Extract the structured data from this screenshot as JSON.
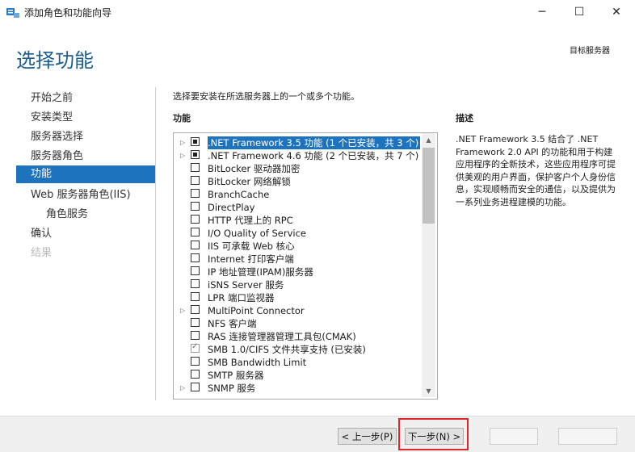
{
  "window": {
    "title": "添加角色和功能向导",
    "minimize": "─",
    "maximize": "☐",
    "close": "✕"
  },
  "header": {
    "page_title": "选择功能",
    "target_server_label": "目标服务器"
  },
  "nav": {
    "items": [
      {
        "label": "开始之前"
      },
      {
        "label": "安装类型"
      },
      {
        "label": "服务器选择"
      },
      {
        "label": "服务器角色"
      },
      {
        "label": "功能"
      },
      {
        "label": "Web 服务器角色(IIS)"
      },
      {
        "label": "角色服务"
      },
      {
        "label": "确认"
      },
      {
        "label": "结果"
      }
    ]
  },
  "content": {
    "instruction": "选择要安装在所选服务器上的一个或多个功能。",
    "features_label": "功能",
    "description_label": "描述",
    "description_text": ".NET Framework 3.5 结合了 .NET Framework 2.0 API 的功能和用于构建应用程序的全新技术，这些应用程序可提供美观的用户界面，保护客户个人身份信息，实现顺畅而安全的通信，以及提供为一系列业务进程建模的功能。",
    "features": [
      {
        "label": ".NET Framework 3.5 功能 (1 个已安装，共 3 个)",
        "expandable": true,
        "state": "partial",
        "selected": true
      },
      {
        "label": ".NET Framework 4.6 功能 (2 个已安装，共 7 个)",
        "expandable": true,
        "state": "partial",
        "selected": false
      },
      {
        "label": "BitLocker 驱动器加密",
        "expandable": false,
        "state": "unchecked",
        "selected": false
      },
      {
        "label": "BitLocker 网络解锁",
        "expandable": false,
        "state": "unchecked",
        "selected": false
      },
      {
        "label": "BranchCache",
        "expandable": false,
        "state": "unchecked",
        "selected": false
      },
      {
        "label": "DirectPlay",
        "expandable": false,
        "state": "unchecked",
        "selected": false
      },
      {
        "label": "HTTP 代理上的 RPC",
        "expandable": false,
        "state": "unchecked",
        "selected": false
      },
      {
        "label": "I/O Quality of Service",
        "expandable": false,
        "state": "unchecked",
        "selected": false
      },
      {
        "label": "IIS 可承载 Web 核心",
        "expandable": false,
        "state": "unchecked",
        "selected": false
      },
      {
        "label": "Internet 打印客户端",
        "expandable": false,
        "state": "unchecked",
        "selected": false
      },
      {
        "label": "IP 地址管理(IPAM)服务器",
        "expandable": false,
        "state": "unchecked",
        "selected": false
      },
      {
        "label": "iSNS Server 服务",
        "expandable": false,
        "state": "unchecked",
        "selected": false
      },
      {
        "label": "LPR 端口监视器",
        "expandable": false,
        "state": "unchecked",
        "selected": false
      },
      {
        "label": "MultiPoint Connector",
        "expandable": true,
        "state": "unchecked",
        "selected": false
      },
      {
        "label": "NFS 客户端",
        "expandable": false,
        "state": "unchecked",
        "selected": false
      },
      {
        "label": "RAS 连接管理器管理工具包(CMAK)",
        "expandable": false,
        "state": "unchecked",
        "selected": false
      },
      {
        "label": "SMB 1.0/CIFS 文件共享支持 (已安装)",
        "expandable": false,
        "state": "checked",
        "selected": false
      },
      {
        "label": "SMB Bandwidth Limit",
        "expandable": false,
        "state": "unchecked",
        "selected": false
      },
      {
        "label": "SMTP 服务器",
        "expandable": false,
        "state": "unchecked",
        "selected": false
      },
      {
        "label": "SNMP 服务",
        "expandable": true,
        "state": "unchecked",
        "selected": false
      }
    ]
  },
  "footer": {
    "prev_label": "< 上一步(P)",
    "next_label": "下一步(N) >",
    "install_label": "",
    "cancel_label": ""
  },
  "icons": {
    "expand": "▷",
    "scroll_up": "▲",
    "scroll_down": "▼"
  },
  "colors": {
    "accent": "#1e73be",
    "title": "#1b5d91",
    "highlight_box": "#e0252b"
  }
}
